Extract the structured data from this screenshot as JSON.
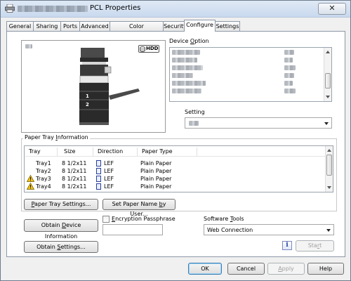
{
  "window": {
    "title": "PCL Properties",
    "close_glyph": "✕"
  },
  "tabs": [
    {
      "label": "General"
    },
    {
      "label": "Sharing"
    },
    {
      "label": "Ports"
    },
    {
      "label": "Advanced"
    },
    {
      "label": "Color Management"
    },
    {
      "label": "Security"
    },
    {
      "label": "Configure",
      "active": true
    },
    {
      "label": "Settings"
    }
  ],
  "printer_preview": {
    "hdd_badge": "HDD",
    "tray_labels": [
      "1",
      "2"
    ]
  },
  "device_option": {
    "label_prefix": "Device ",
    "label_accel": "O",
    "label_suffix": "ption"
  },
  "setting": {
    "label": "Setting"
  },
  "paper_tray": {
    "group_prefix": "Paper Tray ",
    "group_accel": "I",
    "group_suffix": "nformation",
    "columns": [
      "Tray",
      "Size",
      "Direction",
      "Paper Type"
    ],
    "rows": [
      {
        "tray": "Tray1",
        "size": "8 1/2x11",
        "direction": "LEF",
        "type": "Plain Paper",
        "warning": false
      },
      {
        "tray": "Tray2",
        "size": "8 1/2x11",
        "direction": "LEF",
        "type": "Plain Paper",
        "warning": false
      },
      {
        "tray": "Tray3",
        "size": "8 1/2x11",
        "direction": "LEF",
        "type": "Plain Paper",
        "warning": true
      },
      {
        "tray": "Tray4",
        "size": "8 1/2x11",
        "direction": "LEF",
        "type": "Plain Paper",
        "warning": true
      }
    ],
    "settings_prefix": "",
    "settings_accel": "P",
    "settings_suffix": "aper Tray Settings...",
    "set_name_prefix": "Set Paper Name ",
    "set_name_accel": "b",
    "set_name_suffix": "y User..."
  },
  "obtain_device": {
    "prefix": "Obtain ",
    "accel": "D",
    "suffix": "evice Information"
  },
  "encryption": {
    "prefix": "",
    "accel": "E",
    "suffix": "ncryption Passphrase",
    "value": ""
  },
  "obtain_settings": {
    "prefix": "Obtain ",
    "accel": "S",
    "suffix": "ettings..."
  },
  "software_tools": {
    "label_prefix": "Software ",
    "label_accel": "T",
    "label_suffix": "ools",
    "selected": "Web Connection",
    "info_glyph": "i",
    "start_prefix": "Sta",
    "start_accel": "r",
    "start_suffix": "t"
  },
  "footer": {
    "ok": "OK",
    "cancel": "Cancel",
    "apply_prefix": "",
    "apply_accel": "A",
    "apply_suffix": "pply",
    "help": "Help"
  },
  "colors": {
    "warning": "#f2c218",
    "tab_border": "#8d98a6",
    "default_button_border": "#3c7fb1"
  }
}
